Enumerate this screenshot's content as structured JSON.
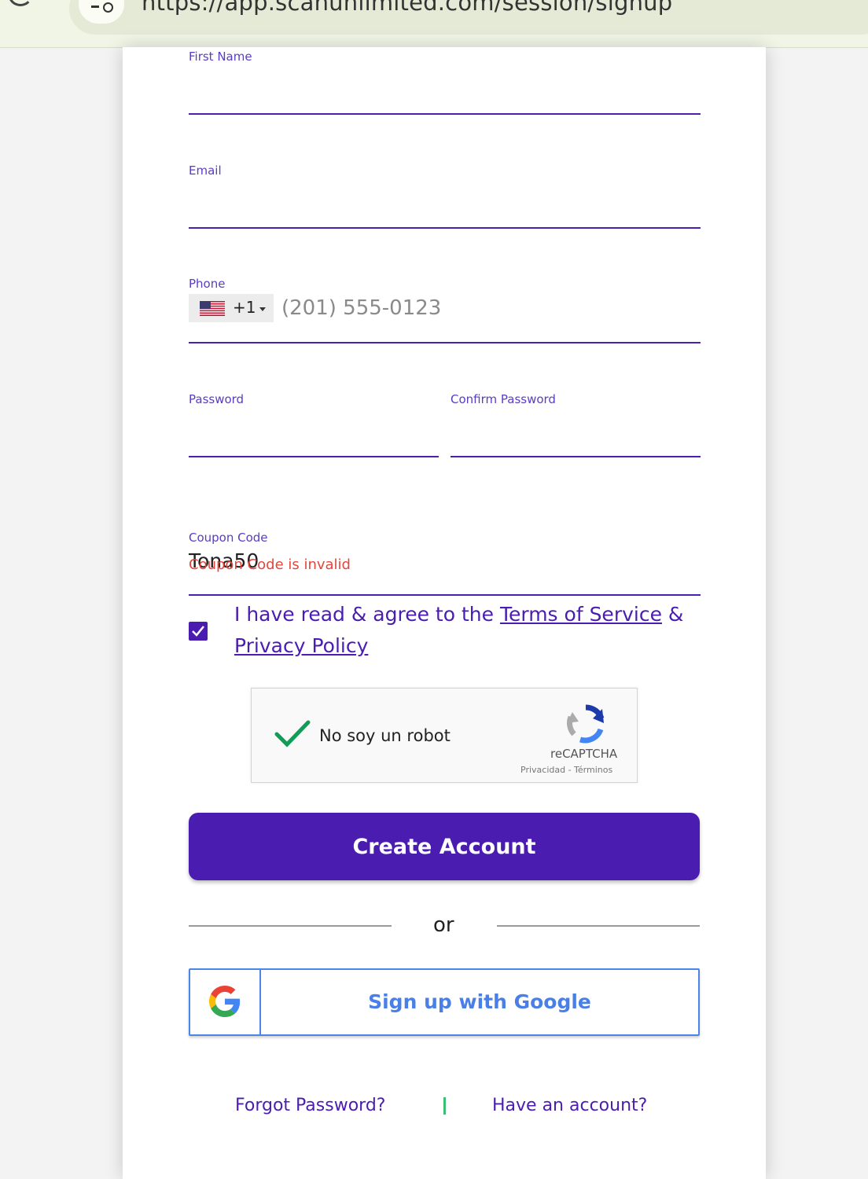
{
  "browser": {
    "url": "https://app.scanunlimited.com/session/signup"
  },
  "form": {
    "first_name": {
      "label": "First Name",
      "value": ""
    },
    "email": {
      "label": "Email",
      "value": ""
    },
    "phone": {
      "label": "Phone",
      "country_code": "+1",
      "country_flag": "US",
      "placeholder": "(201) 555-0123",
      "value": ""
    },
    "password": {
      "label": "Password",
      "value": ""
    },
    "confirm_password": {
      "label": "Confirm Password",
      "value": ""
    },
    "coupon": {
      "label": "Coupon Code",
      "value": "Tona50",
      "error": "Coupon Code is invalid"
    },
    "agree": {
      "checked": true,
      "text_prefix": "I have read & agree to the ",
      "terms_link": "Terms of Service",
      "text_mid": " & ",
      "privacy_link": "Privacy Policy"
    }
  },
  "recaptcha": {
    "label": "No soy un robot",
    "brand": "reCAPTCHA",
    "links": "Privacidad - Términos",
    "checked": true
  },
  "actions": {
    "create_account": "Create Account",
    "or_text": "or",
    "google_signup": "Sign up with Google"
  },
  "footer": {
    "forgot_password": "Forgot Password?",
    "have_account": "Have an account?"
  },
  "colors": {
    "primary": "#4a1db0",
    "error": "#e4463b",
    "google_blue": "#4a86e8",
    "separator_green": "#3cbf72"
  }
}
